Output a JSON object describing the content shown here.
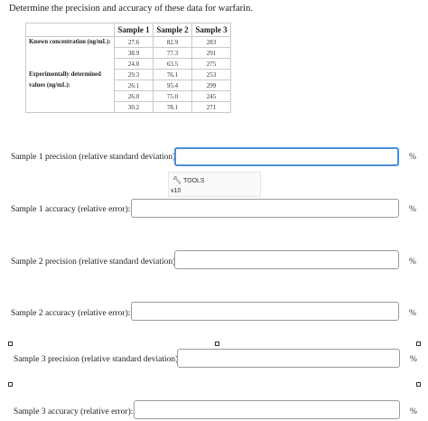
{
  "question": "Determine the precision and accuracy of these data for warfarin.",
  "table": {
    "headers": [
      "Sample 1",
      "Sample 2",
      "Sample 3"
    ],
    "known_label": "Known concentration (ng/mL):",
    "known": [
      "27.6",
      "82.9",
      "283"
    ],
    "exp_label_line1": "Experimentally determined",
    "exp_label_line2": "values (ng/mL):",
    "experimental": [
      [
        "38.9",
        "77.3",
        "291"
      ],
      [
        "24.0",
        "63.5",
        "275"
      ],
      [
        "29.3",
        "76.1",
        "253"
      ],
      [
        "26.1",
        "95.4",
        "299"
      ],
      [
        "26.0",
        "75.0",
        "245"
      ],
      [
        "30.2",
        "78.1",
        "271"
      ]
    ]
  },
  "fields": [
    {
      "label": "Sample 1 precision (relative standard deviation):",
      "value": "",
      "unit": "%"
    },
    {
      "label": "Sample 1 accuracy (relative error):",
      "value": "",
      "unit": "%"
    },
    {
      "label": "Sample 2 precision (relative standard deviation):",
      "value": "",
      "unit": "%"
    },
    {
      "label": "Sample 2 accuracy (relative error):",
      "value": "",
      "unit": "%"
    },
    {
      "label": "Sample 3 precision (relative standard deviation):",
      "value": "",
      "unit": "%"
    },
    {
      "label": "Sample 3 accuracy (relative error):",
      "value": "",
      "unit": "%"
    }
  ],
  "tools": {
    "label": "TOOLS",
    "sci_notation": "x10",
    "icon": "wrench-icon"
  }
}
